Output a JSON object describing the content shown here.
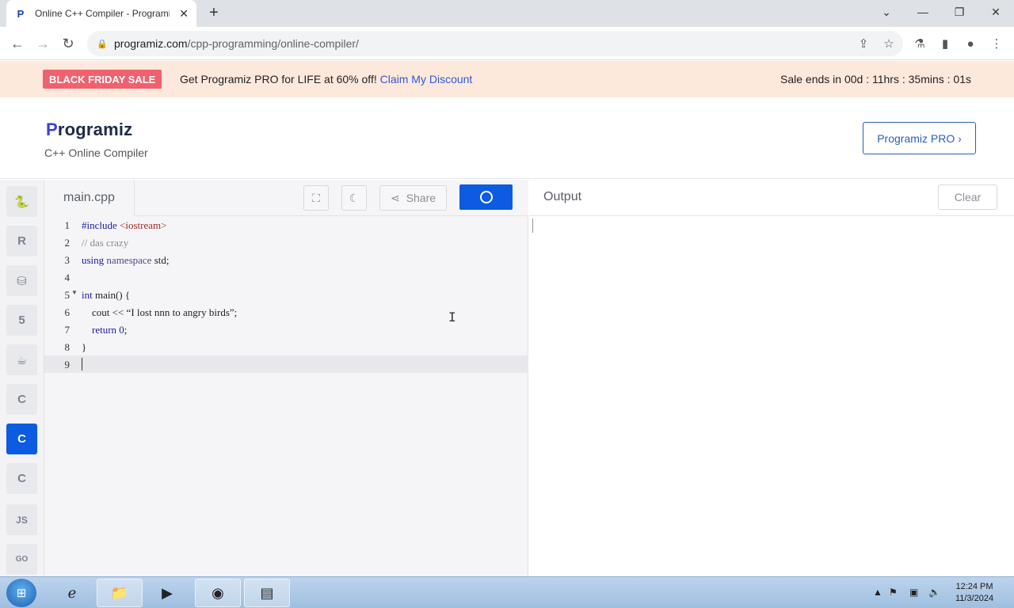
{
  "browser": {
    "tab_title": "Online C++ Compiler - Programiz",
    "favicon": "P",
    "address": {
      "domain": "programiz.com",
      "path": "/cpp-programming/online-compiler/"
    }
  },
  "banner": {
    "badge": "BLACK FRIDAY SALE",
    "text": "Get Programiz PRO for LIFE at 60% off!",
    "link": "Claim My Discount",
    "timer": "Sale ends in 00d : 11hrs : 35mins : 01s"
  },
  "header": {
    "logo_p": "P",
    "logo_rest": "rogramiz",
    "subtitle": "C++ Online Compiler",
    "pro_button": "Programiz PRO ›"
  },
  "sidebar": {
    "languages": [
      {
        "name": "python",
        "glyph": "🐍"
      },
      {
        "name": "r",
        "glyph": "R"
      },
      {
        "name": "sql",
        "glyph": "⛁"
      },
      {
        "name": "html",
        "glyph": "5"
      },
      {
        "name": "java",
        "glyph": "☕"
      },
      {
        "name": "c",
        "glyph": "C"
      },
      {
        "name": "cpp",
        "glyph": "C"
      },
      {
        "name": "csharp",
        "glyph": "C"
      },
      {
        "name": "js",
        "glyph": "JS"
      },
      {
        "name": "go",
        "glyph": "GO"
      }
    ]
  },
  "editor": {
    "filename": "main.cpp",
    "share_label": "Share",
    "lines": [
      {
        "n": "1",
        "a": "#include ",
        "b": "<iostream>"
      },
      {
        "n": "2",
        "a": "// das crazy"
      },
      {
        "n": "3",
        "a": "using ",
        "b": "namespace ",
        "c": "std;"
      },
      {
        "n": "4",
        "a": ""
      },
      {
        "n": "5",
        "a": "int ",
        "b": "main() {"
      },
      {
        "n": "6",
        "a": "    cout << ",
        "b": "“I lost nnn to angry birds”",
        "c": ";"
      },
      {
        "n": "7",
        "a": "    return ",
        "b": "0",
        "c": ";"
      },
      {
        "n": "8",
        "a": "}"
      },
      {
        "n": "9",
        "a": ""
      }
    ]
  },
  "output": {
    "title": "Output",
    "clear_label": "Clear"
  },
  "taskbar": {
    "time": "12:24 PM",
    "date": "11/3/2024"
  }
}
